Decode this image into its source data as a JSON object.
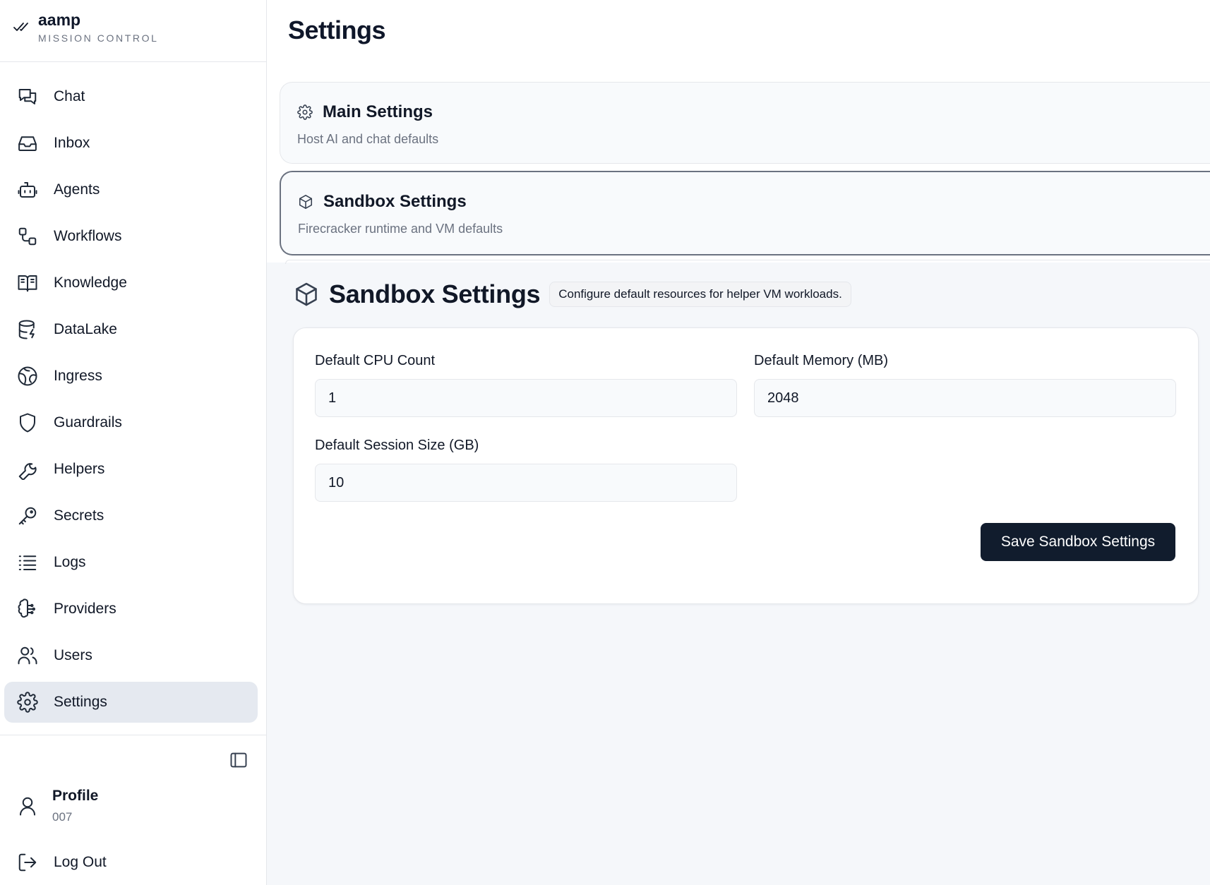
{
  "brand": {
    "name": "aamp",
    "subtitle": "MISSION CONTROL",
    "icon": "double-check-icon"
  },
  "sidebar": {
    "items": [
      {
        "label": "Chat",
        "icon": "chat-icon",
        "active": false
      },
      {
        "label": "Inbox",
        "icon": "inbox-icon",
        "active": false
      },
      {
        "label": "Agents",
        "icon": "bot-icon",
        "active": false
      },
      {
        "label": "Workflows",
        "icon": "workflow-icon",
        "active": false
      },
      {
        "label": "Knowledge",
        "icon": "book-icon",
        "active": false
      },
      {
        "label": "DataLake",
        "icon": "database-icon",
        "active": false
      },
      {
        "label": "Ingress",
        "icon": "globe-icon",
        "active": false
      },
      {
        "label": "Guardrails",
        "icon": "shield-icon",
        "active": false
      },
      {
        "label": "Helpers",
        "icon": "wrench-icon",
        "active": false
      },
      {
        "label": "Secrets",
        "icon": "key-icon",
        "active": false
      },
      {
        "label": "Logs",
        "icon": "list-icon",
        "active": false
      },
      {
        "label": "Providers",
        "icon": "brain-icon",
        "active": false
      },
      {
        "label": "Users",
        "icon": "users-icon",
        "active": false
      },
      {
        "label": "Settings",
        "icon": "gear-icon",
        "active": true
      }
    ],
    "collapse_icon": "sidebar-toggle-icon",
    "profile": {
      "name": "Profile",
      "id": "007",
      "icon": "user-icon"
    },
    "logout": {
      "label": "Log Out",
      "icon": "logout-icon"
    }
  },
  "page": {
    "title": "Settings"
  },
  "sections": {
    "main": {
      "title": "Main Settings",
      "description": "Host AI and chat defaults",
      "icon": "gear-icon"
    },
    "sandbox": {
      "title": "Sandbox Settings",
      "description": "Firecracker runtime and VM defaults",
      "icon": "box-icon"
    }
  },
  "detail": {
    "title": "Sandbox Settings",
    "badge": "Configure default resources for helper VM workloads.",
    "icon": "box-icon",
    "fields": {
      "cpu": {
        "label": "Default CPU Count",
        "value": "1"
      },
      "memory": {
        "label": "Default Memory (MB)",
        "value": "2048"
      },
      "session_size": {
        "label": "Default Session Size (GB)",
        "value": "10"
      }
    },
    "save_label": "Save Sandbox Settings"
  },
  "colors": {
    "active_nav_bg": "#e5e9f0",
    "primary_button": "#111c2d",
    "page_bg": "#f5f7fa"
  }
}
